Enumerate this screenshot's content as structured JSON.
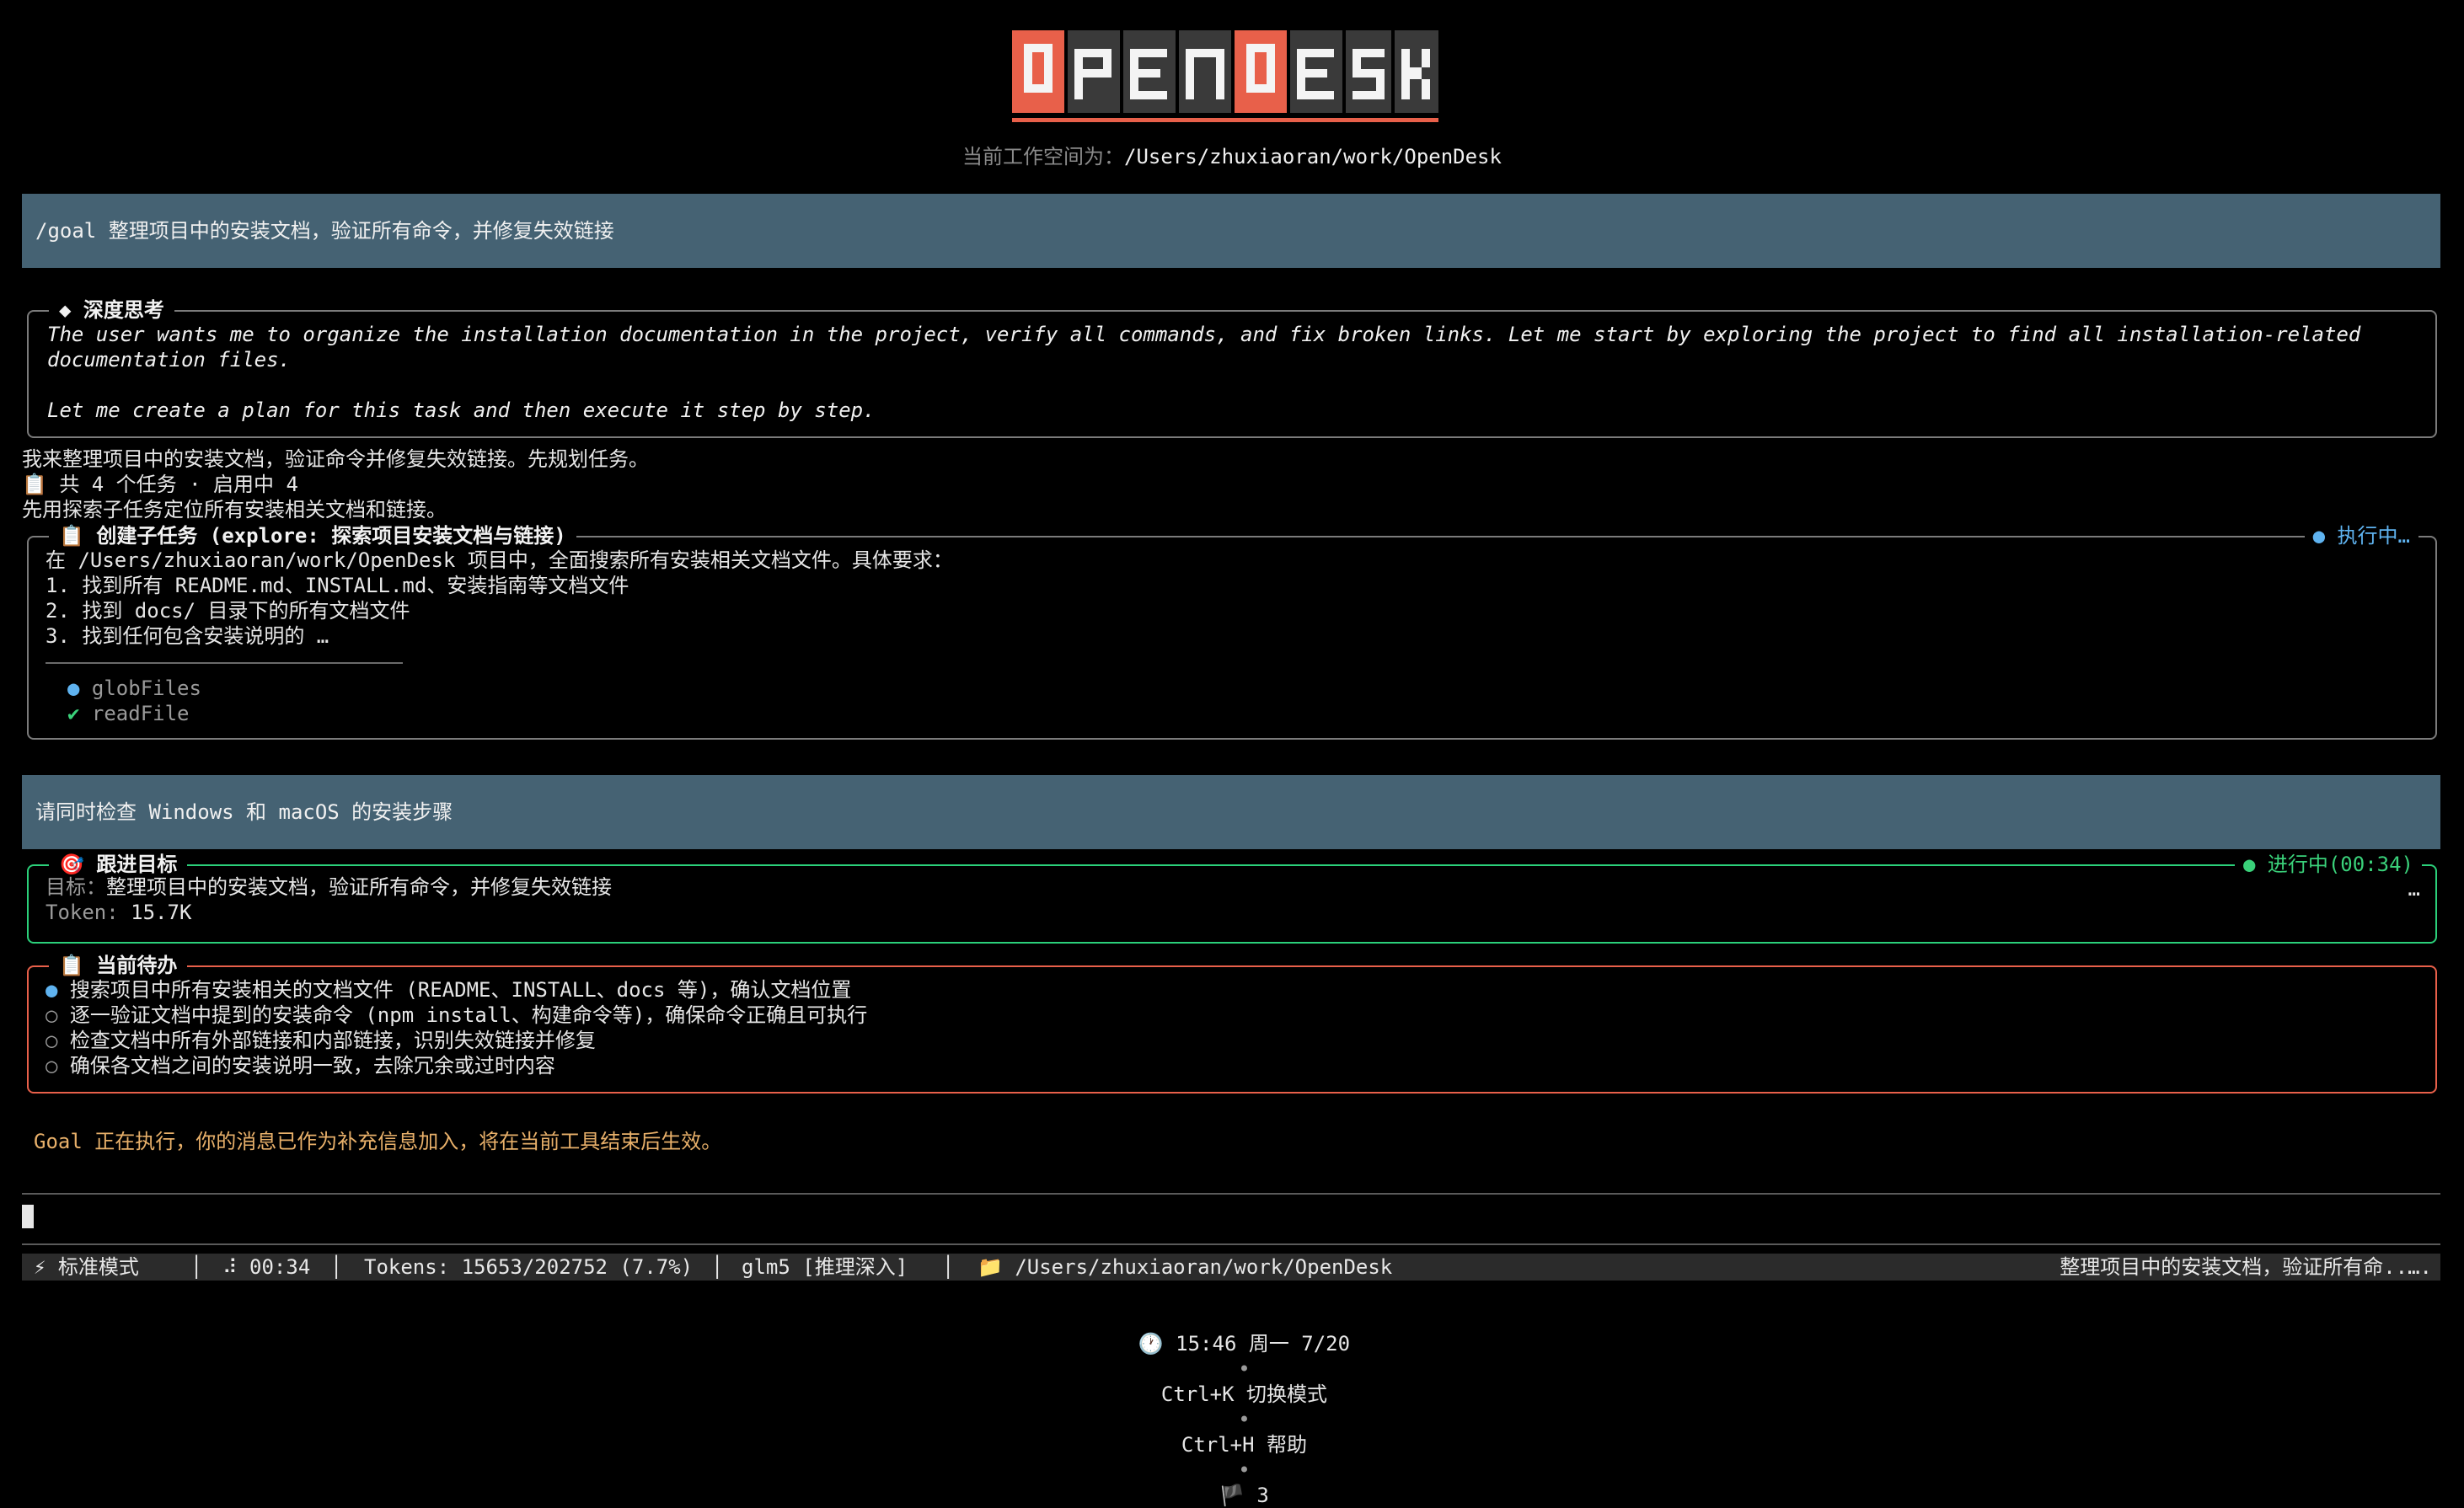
{
  "app": {
    "logo_text": "OPENDESK",
    "workspace_label": "当前工作空间为：",
    "workspace_path": "/Users/zhuxiaoran/work/OpenDesk"
  },
  "colors": {
    "user_msg_bg": "#456273",
    "logo_accent": "#e8604a",
    "goal_border": "#2bd07a",
    "todo_border": "#e8604a",
    "running_blue": "#5fb3f0"
  },
  "user_messages": [
    "/goal 整理项目中的安装文档，验证所有命令，并修复失效链接",
    "请同时检查 Windows 和 macOS 的安装步骤"
  ],
  "thinking": {
    "title": "◆ 深度思考",
    "lines": [
      "The user wants me to organize the installation documentation in the project, verify all commands, and fix broken links. Let me start by exploring the project to find all installation-related",
      "documentation files.",
      "",
      "Let me create a plan for this task and then execute it step by step."
    ]
  },
  "assistant": {
    "line1": "我来整理项目中的安装文档，验证命令并修复失效链接。先规划任务。",
    "line2": "📋 共 4 个任务 · 启用中 4",
    "line3": "先用探索子任务定位所有安装相关文档和链接。"
  },
  "subtask": {
    "title": "📋 创建子任务 (explore: 探索项目安装文档与链接)",
    "status": "● 执行中…",
    "lines": [
      "在 /Users/zhuxiaoran/work/OpenDesk 项目中，全面搜索所有安装相关文档文件。具体要求：",
      "1. 找到所有 README.md、INSTALL.md、安装指南等文档文件",
      "2. 找到 docs/ 目录下的所有文档文件",
      "3. 找到任何包含安装说明的 …"
    ],
    "tools": [
      {
        "icon": "●",
        "name": "globFiles"
      },
      {
        "icon": "✔",
        "name": "readFile"
      }
    ]
  },
  "goal": {
    "title": "🎯 跟进目标",
    "status": "● 进行中(00:34)",
    "target_label": "目标：",
    "target_value": "整理项目中的安装文档，验证所有命令，并修复失效链接",
    "token_label": "Token:",
    "token_value": "15.7K",
    "more": "…"
  },
  "todo": {
    "title": "📋 当前待办",
    "items": [
      {
        "mark": "●",
        "text": "搜索项目中所有安装相关的文档文件 (README、INSTALL、docs 等)，确认文档位置"
      },
      {
        "mark": "○",
        "text": "逐一验证文档中提到的安装命令 (npm install、构建命令等)，确保命令正确且可执行"
      },
      {
        "mark": "○",
        "text": "检查文档中所有外部链接和内部链接，识别失效链接并修复"
      },
      {
        "mark": "○",
        "text": "确保各文档之间的安装说明一致，去除冗余或过时内容"
      }
    ]
  },
  "notice": "Goal 正在执行，你的消息已作为补充信息加入，将在当前工具结束后生效。",
  "status_bar": {
    "mode": "⚡ 标准模式",
    "timer": "⠼ 00:34",
    "tokens": "Tokens: 15653/202752 (7.7%)",
    "model": "glm5 [推理深入]",
    "path": "📁 /Users/zhuxiaoran/work/OpenDesk",
    "goal_preview": "整理项目中的安装文档，验证所有命..…."
  },
  "footer": {
    "clock": "🕐 15:46 周一 7/20",
    "shortcut_mode": "Ctrl+K 切换模式",
    "shortcut_help": "Ctrl+H 帮助",
    "flags": "🏴 3"
  }
}
